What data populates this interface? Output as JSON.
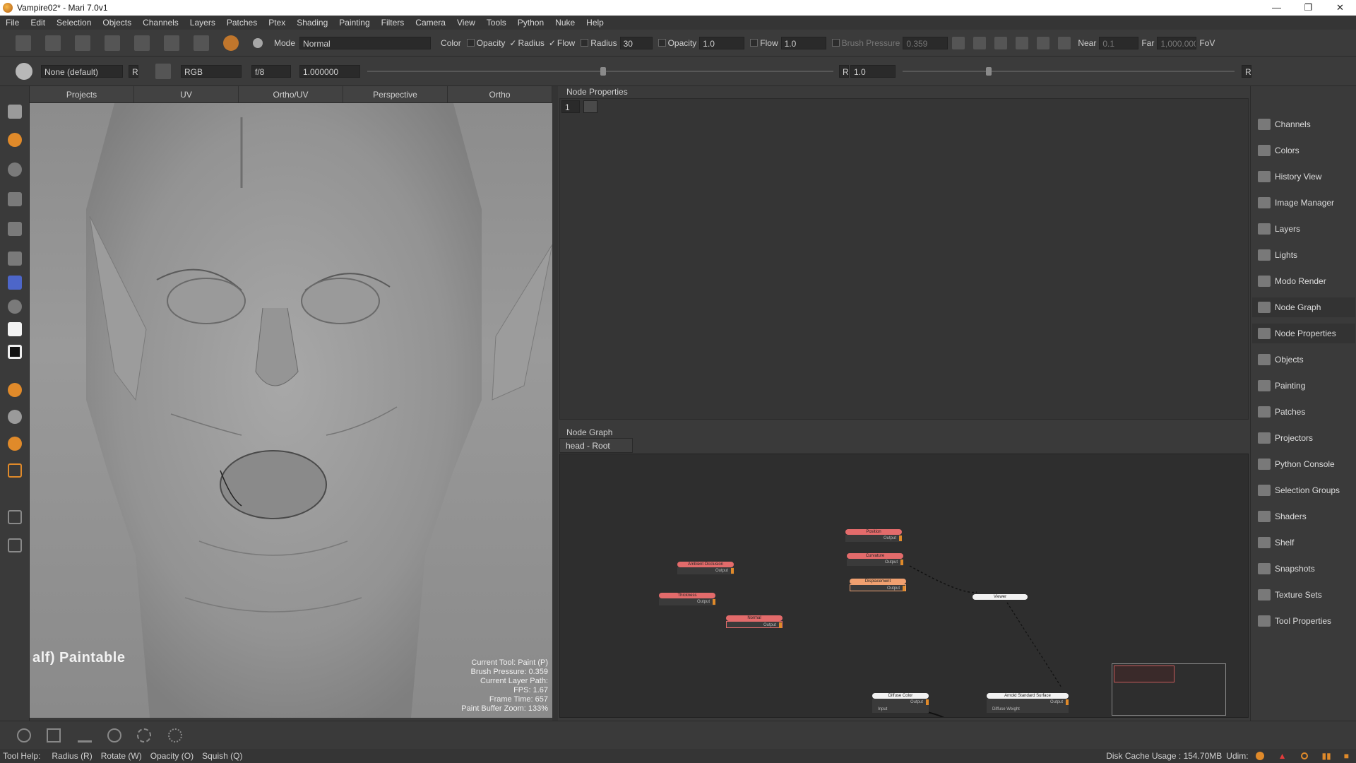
{
  "window": {
    "title": "Vampire02* - Mari 7.0v1",
    "controls": [
      "—",
      "❐",
      "✕"
    ]
  },
  "menu": [
    "File",
    "Edit",
    "Selection",
    "Objects",
    "Channels",
    "Layers",
    "Patches",
    "Ptex",
    "Shading",
    "Painting",
    "Filters",
    "Camera",
    "View",
    "Tools",
    "Python",
    "Nuke",
    "Help"
  ],
  "toolbar1": {
    "mode_label": "Mode",
    "mode_value": "Normal",
    "color_label": "Color",
    "opacity_label": "Opacity",
    "radius_toggle_label": "Radius",
    "flow_toggle_label": "Flow",
    "radius_label": "Radius",
    "radius_value": "30",
    "opacity2_label": "Opacity",
    "opacity_value": "1.0",
    "flow_label": "Flow",
    "flow_value": "1.0",
    "brush_pressure_label": "Brush Pressure",
    "brush_pressure_value": "0.359",
    "near_label": "Near",
    "near_value": "0.1",
    "far_label": "Far",
    "far_value": "1,000.000",
    "fov_label": "FoV"
  },
  "toolbar2": {
    "channel_value": "None (default)",
    "r_button": "R",
    "colorspace_value": "RGB",
    "fstop_value": "f/8",
    "gain_value": "1.000000",
    "r2_label": "R",
    "gamma_value": "1.0",
    "r3_label": "R",
    "exposure_slider_fraction": 0.5,
    "gamma_slider_fraction": 0.25
  },
  "view_tabs": [
    "Projects",
    "UV",
    "Ortho/UV",
    "Perspective",
    "Ortho"
  ],
  "viewport": {
    "paintable_label": "alf) Paintable",
    "hud_lines": [
      "Current Tool: Paint (P)",
      "Brush Pressure: 0.359",
      "Current Layer Path:",
      "FPS: 1.67",
      "Frame Time: 657",
      "Paint Buffer Zoom: 133%"
    ]
  },
  "node_properties": {
    "title": "Node Properties",
    "count_value": "1"
  },
  "node_graph": {
    "title": "Node Graph",
    "tab": "head - Root",
    "nodes": [
      {
        "name": "Ambient Occlusion",
        "output": "Output",
        "color": "red"
      },
      {
        "name": "Thickness",
        "output": "Output",
        "color": "red"
      },
      {
        "name": "Normal",
        "output": "Output",
        "color": "red"
      },
      {
        "name": "Position",
        "output": "Output",
        "color": "red"
      },
      {
        "name": "Curvature",
        "output": "Output",
        "color": "red"
      },
      {
        "name": "Displacement",
        "output": "Output",
        "color": "orange"
      },
      {
        "name": "Viewer",
        "output": "",
        "color": "white"
      },
      {
        "name": "Diffuse Color",
        "output": "Output",
        "input": "Input",
        "color": "white"
      },
      {
        "name": "Arnold Standard Surface",
        "output": "Output",
        "input": "Diffuse Weight",
        "color": "white"
      }
    ]
  },
  "dock": [
    {
      "label": "Channels",
      "icon": "channels-icon"
    },
    {
      "label": "Colors",
      "icon": "colors-icon"
    },
    {
      "label": "History View",
      "icon": "history-icon"
    },
    {
      "label": "Image Manager",
      "icon": "image-manager-icon"
    },
    {
      "label": "Layers",
      "icon": "layers-icon"
    },
    {
      "label": "Lights",
      "icon": "lights-icon"
    },
    {
      "label": "Modo Render",
      "icon": "modo-render-icon"
    },
    {
      "label": "Node Graph",
      "icon": "node-graph-icon"
    },
    {
      "label": "Node Properties",
      "icon": "node-properties-icon"
    },
    {
      "label": "Objects",
      "icon": "objects-icon"
    },
    {
      "label": "Painting",
      "icon": "painting-icon"
    },
    {
      "label": "Patches",
      "icon": "patches-icon"
    },
    {
      "label": "Projectors",
      "icon": "projectors-icon"
    },
    {
      "label": "Python Console",
      "icon": "python-console-icon"
    },
    {
      "label": "Selection Groups",
      "icon": "selection-groups-icon"
    },
    {
      "label": "Shaders",
      "icon": "shaders-icon"
    },
    {
      "label": "Shelf",
      "icon": "shelf-icon"
    },
    {
      "label": "Snapshots",
      "icon": "snapshots-icon"
    },
    {
      "label": "Texture Sets",
      "icon": "texture-sets-icon"
    },
    {
      "label": "Tool Properties",
      "icon": "tool-properties-icon"
    }
  ],
  "status": {
    "tool_help_label": "Tool Help:",
    "hints": [
      "Radius (R)",
      "Rotate (W)",
      "Opacity (O)",
      "Squish (Q)"
    ],
    "disk_cache": "Disk Cache Usage : 154.70MB",
    "udim_label": "Udim:"
  }
}
